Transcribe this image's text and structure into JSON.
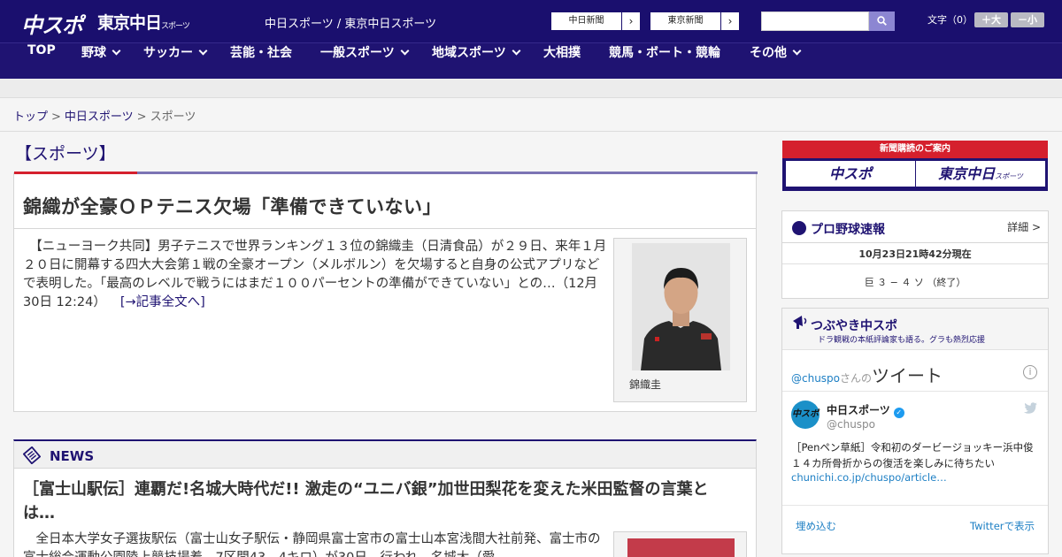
{
  "header": {
    "logo_chuspo": "中スポ",
    "logo_tokyo": "東京中日",
    "logo_tokyo_suffix": "スポーツ",
    "tagline": "中日スポーツ / 東京中日スポーツ",
    "link_chunichi": "中日新聞",
    "link_tokyo": "東京新聞",
    "search": {
      "placeholder": ""
    },
    "fontsize": {
      "label": "文字（0）",
      "bigger": "＋大",
      "smaller": "－小"
    },
    "colors": {
      "header_bg": "#1a0f6e",
      "nav_bg": "#1f1372",
      "accent_red": "#d5202d"
    }
  },
  "nav": {
    "items": [
      {
        "label": "TOP",
        "dropdown": false
      },
      {
        "label": "野球",
        "dropdown": true
      },
      {
        "label": "サッカー",
        "dropdown": true
      },
      {
        "label": "芸能・社会",
        "dropdown": false
      },
      {
        "label": "一般スポーツ",
        "dropdown": true
      },
      {
        "label": "地域スポーツ",
        "dropdown": true
      },
      {
        "label": "大相撲",
        "dropdown": false
      },
      {
        "label": "競馬・ボート・競輪",
        "dropdown": false
      },
      {
        "label": "その他",
        "dropdown": true
      }
    ]
  },
  "breadcrumb": {
    "items": [
      "トップ",
      "中日スポーツ",
      "スポーツ"
    ],
    "sep": ">"
  },
  "main": {
    "section_title": "【スポーツ】",
    "article": {
      "headline": "錦織が全豪ＯＰテニス欠場「準備できていない」",
      "body": "　【ニューヨーク共同】男子テニスで世界ランキング１３位の錦織圭（日清食品）が２９日、来年１月２０日に開幕する四大大会第１戦の全豪オープン（メルボルン）を欠場すると自身の公式アプリなどで表明した。「最高のレベルで戦うにはまだ１００パーセントの準備ができていない」との…（12月30日 12:24）",
      "more": "[→記事全文へ]",
      "photo_caption": "錦織圭"
    },
    "news": {
      "title": "NEWS",
      "headline": "［富士山駅伝］連覇だ!名城大時代だ!! 激走の“ユニバ銀”加世田梨花を変えた米田監督の言葉とは…",
      "body": "　全日本大学女子選抜駅伝（富士山女子駅伝・静岡県富士宮市の富士山本宮浅間大社前発、富士市の富士総合運動公園陸上競技場着、7区間43．4キロ）が30日、行われ、名城大（愛"
    }
  },
  "sidebar": {
    "subscription": {
      "title": "新聞購読のご案内",
      "logo_chuspo": "中スポ",
      "logo_tokyo": "東京中日",
      "logo_tokyo_suffix": "スポーツ"
    },
    "baseball": {
      "title": "プロ野球速報",
      "more": "詳細 >",
      "timestamp": "10月23日21時42分現在",
      "score": "巨 ３ − ４ ソ （終了）"
    },
    "twitter": {
      "title": "つぶやき中スポ",
      "subtitle": "ドラ観戦の本紙評論家も語る。グラも熱烈応援",
      "handle_link": "@chuspo",
      "handle_suffix": "さんの",
      "tweet_label": "ツイート",
      "info": "i",
      "avatar_text": "中スポ",
      "account_name": "中日スポーツ",
      "account_handle": "@chuspo",
      "tweet_text": "［Penペン草紙］令和初のダービージョッキー浜中俊　１４カ所骨折からの復活を楽しみに待ちたい",
      "tweet_link": "chunichi.co.jp/chuspo/article…",
      "embed": "埋め込む",
      "view_on": "Twitterで表示"
    }
  }
}
